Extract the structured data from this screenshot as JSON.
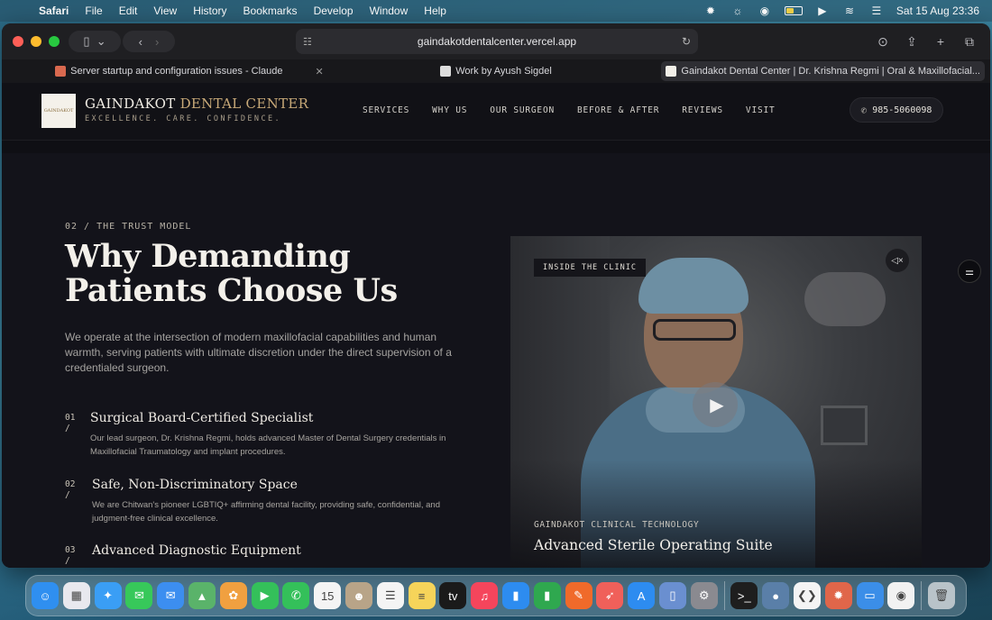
{
  "menubar": {
    "app": "Safari",
    "items": [
      "File",
      "Edit",
      "View",
      "History",
      "Bookmarks",
      "Develop",
      "Window",
      "Help"
    ],
    "clock": "Sat 15 Aug  23:36"
  },
  "browser": {
    "url": "gaindakotdentalcenter.vercel.app",
    "tabs": [
      {
        "title": "Server startup and configuration issues - Claude",
        "active": false
      },
      {
        "title": "Work by Ayush Sigdel",
        "active": false
      },
      {
        "title": "Gaindakot Dental Center | Dr. Krishna Regmi | Oral & Maxillofacial...",
        "active": true
      }
    ]
  },
  "site": {
    "logo_text": "GAINDAKOT",
    "brand_first": "GAINDAKOT ",
    "brand_accent": "DENTAL CENTER",
    "tagline": "EXCELLENCE. CARE. CONFIDENCE.",
    "nav": [
      "SERVICES",
      "WHY US",
      "OUR SURGEON",
      "BEFORE & AFTER",
      "REVIEWS",
      "VISIT"
    ],
    "phone": "985-5060098",
    "eyebrow": "02 / THE TRUST MODEL",
    "headline": "Why Demanding Patients Choose Us",
    "lead": "We operate at the intersection of modern maxillofacial capabilities and human warmth, serving patients with ultimate discretion under the direct supervision of a credentialed surgeon.",
    "features": [
      {
        "num": "01 /",
        "title": "Surgical Board-Certified Specialist",
        "desc": "Our lead surgeon, Dr. Krishna Regmi, holds advanced Master of Dental Surgery credentials in Maxillofacial Traumatology and implant procedures."
      },
      {
        "num": "02 /",
        "title": "Safe, Non-Discriminatory Space",
        "desc": "We are Chitwan's pioneer LGBTIQ+ affirming dental facility, providing safe, confidential, and judgment-free clinical excellence."
      },
      {
        "num": "03 /",
        "title": "Advanced Diagnostic Equipment",
        "desc": ""
      }
    ],
    "video": {
      "badge": "INSIDE THE CLINIC",
      "caption_label": "GAINDAKOT CLINICAL TECHNOLOGY",
      "caption_title": "Advanced Sterile Operating Suite"
    }
  },
  "dock": {
    "apps": [
      {
        "icon": "finder-icon",
        "color": "#2f8ff0",
        "glyph": "☺"
      },
      {
        "icon": "launchpad-icon",
        "color": "#e8e8ee",
        "glyph": "▦"
      },
      {
        "icon": "safari-icon",
        "color": "#3a9ef5",
        "glyph": "✦"
      },
      {
        "icon": "messages-icon",
        "color": "#37c85a",
        "glyph": "✉"
      },
      {
        "icon": "mail-icon",
        "color": "#3c8ef0",
        "glyph": "✉"
      },
      {
        "icon": "maps-icon",
        "color": "#5ab36a",
        "glyph": "▲"
      },
      {
        "icon": "photos-icon",
        "color": "#f0a040",
        "glyph": "✿"
      },
      {
        "icon": "facetime-icon",
        "color": "#34c05a",
        "glyph": "▶"
      },
      {
        "icon": "phone-icon",
        "color": "#34c05a",
        "glyph": "✆"
      },
      {
        "icon": "calendar-icon",
        "color": "#f4f4f4",
        "glyph": "15"
      },
      {
        "icon": "contacts-icon",
        "color": "#b8a488",
        "glyph": "☻"
      },
      {
        "icon": "reminders-icon",
        "color": "#f4f4f4",
        "glyph": "☰"
      },
      {
        "icon": "notes-icon",
        "color": "#f6d45a",
        "glyph": "≡"
      },
      {
        "icon": "tv-icon",
        "color": "#1a1a1a",
        "glyph": "tv"
      },
      {
        "icon": "music-icon",
        "color": "#f5455c",
        "glyph": "♫"
      },
      {
        "icon": "keynote-icon",
        "color": "#2d8cf0",
        "glyph": "▮"
      },
      {
        "icon": "numbers-icon",
        "color": "#2fa84f",
        "glyph": "▮"
      },
      {
        "icon": "pages-icon",
        "color": "#f06a2a",
        "glyph": "✎"
      },
      {
        "icon": "rocket-icon",
        "color": "#f0605a",
        "glyph": "➶"
      },
      {
        "icon": "appstore-icon",
        "color": "#2d8cf0",
        "glyph": "A"
      },
      {
        "icon": "preview-icon",
        "color": "#6a8fd0",
        "glyph": "▯"
      },
      {
        "icon": "settings-icon",
        "color": "#8a8a90",
        "glyph": "⚙"
      },
      {
        "sep": true
      },
      {
        "icon": "terminal-icon",
        "color": "#1e1e1e",
        "glyph": ">_"
      },
      {
        "icon": "disk-icon",
        "color": "#5a7fa8",
        "glyph": "●"
      },
      {
        "icon": "vscode-icon",
        "color": "#f4f4f4",
        "glyph": "❮❯"
      },
      {
        "icon": "claude-icon",
        "color": "#e0664a",
        "glyph": "✹"
      },
      {
        "icon": "files-icon",
        "color": "#3b8ee8",
        "glyph": "▭"
      },
      {
        "icon": "chrome-icon",
        "color": "#f2f2f2",
        "glyph": "◉"
      },
      {
        "sep": true
      },
      {
        "icon": "trash-icon",
        "color": "#b9c3c9",
        "glyph": "🗑"
      }
    ]
  }
}
